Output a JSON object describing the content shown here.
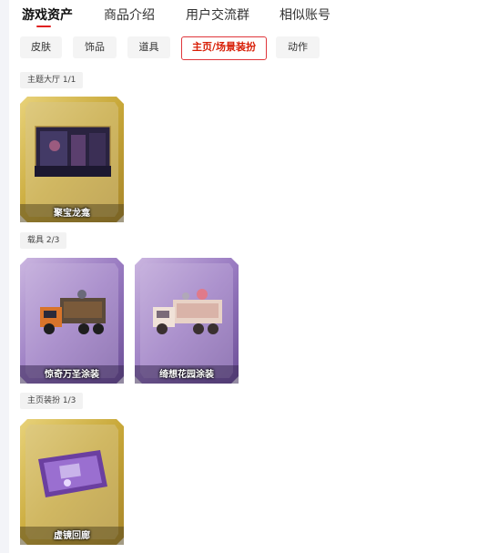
{
  "tabs": [
    {
      "label": "游戏资产",
      "active": true
    },
    {
      "label": "商品介绍",
      "active": false
    },
    {
      "label": "用户交流群",
      "active": false
    },
    {
      "label": "相似账号",
      "active": false
    }
  ],
  "filters": [
    {
      "label": "皮肤",
      "active": false
    },
    {
      "label": "饰品",
      "active": false
    },
    {
      "label": "道具",
      "active": false
    },
    {
      "label": "主页/场景装扮",
      "active": true
    },
    {
      "label": "动作",
      "active": false
    }
  ],
  "sections": [
    {
      "label": "主题大厅 1/1",
      "items": [
        {
          "name": "聚宝龙龛",
          "rarity": "gold"
        }
      ]
    },
    {
      "label": "载具 2/3",
      "items": [
        {
          "name": "惊奇万圣涂装",
          "rarity": "purple"
        },
        {
          "name": "绮想花园涂装",
          "rarity": "purple"
        }
      ]
    },
    {
      "label": "主页装扮 1/3",
      "items": [
        {
          "name": "虚镜回廊",
          "rarity": "gold"
        }
      ]
    }
  ],
  "colors": {
    "accent": "#e0363b",
    "gold_frame": "#c9a93a",
    "purple_frame": "#8a6ab0"
  }
}
